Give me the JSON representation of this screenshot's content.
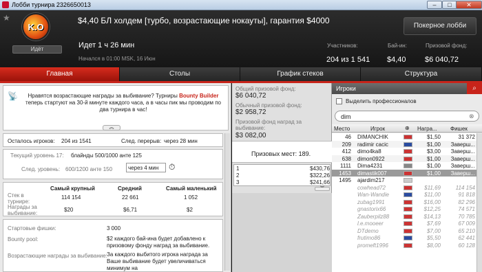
{
  "window": {
    "title": "Лобби турнира 2326650013",
    "min": "–",
    "max": "□",
    "close": "✕"
  },
  "header": {
    "logo_text": "K.O",
    "status": "Идёт",
    "title": "$4,40 БЛ холдем [турбо, возрастающие нокауты], гарантия $4000",
    "running": "Идет 1 ч 26 мин",
    "started": "Начался в 01:00 MSK, 16 Июн",
    "lobby_button": "Покерное лобби",
    "participants_label": "Участников:",
    "participants_value": "204 из 1 541",
    "buyin_label": "Бай-ин:",
    "buyin_value": "$4,40",
    "prize_label": "Призовой фонд:",
    "prize_value": "$6 040,72"
  },
  "tabs": [
    "Главная",
    "Столы",
    "График стеков",
    "Структура"
  ],
  "notice": "Нравятся возрастающие награды за выбивание? Турниры Bounty Builder теперь стартуют на 30-й минуте каждого часа, а в часы пик мы проводим по два турнира в час!",
  "info": {
    "remaining_label": "Осталось игроков:",
    "remaining_value": "204 из 1541",
    "break_label": "След. перерыв:",
    "break_value": "через 28 мин",
    "level_label": "Текущий уровень 17:",
    "level_value": "блайнды 500/1000 анте 125",
    "next_label": "След. уровень:",
    "next_value": "600/1200 анте 150",
    "next_time": "через 4 мин"
  },
  "stacks": {
    "headers": [
      "Самый крупный",
      "Средний",
      "Самый маленький"
    ],
    "row1_label": "Стек в турнире:",
    "row1": [
      "114 154",
      "22 661",
      "1 052"
    ],
    "row2_label": "Награды за выбивание:",
    "row2": [
      "$20",
      "$6,71",
      "$2"
    ]
  },
  "details": {
    "start_label": "Стартовые фишки:",
    "start_value": "3 000",
    "pool_label": "Bounty pool:",
    "pool_value": "$2 каждого бай-ина будет добавлено к призовому фонду наград за выбивание.",
    "inc_label": "Возрастающие награды за выбивание:",
    "inc_value": "За каждого выбитого игрока награда за Ваше выбивание будет увеличиваться минимум на"
  },
  "prizes": {
    "total_label": "Общий призовой фонд:",
    "total_value": "$6 040,72",
    "normal_label": "Обычный призовой фонд:",
    "normal_value": "$2 958,72",
    "bounty_label": "Призовой фонд наград за выбивание:",
    "bounty_value": "$3 082,00",
    "places": "Призовых мест: 189.",
    "rows": [
      {
        "place": "1",
        "amount": "$430,76"
      },
      {
        "place": "2",
        "amount": "$322,26"
      },
      {
        "place": "3",
        "amount": "$241,66"
      }
    ]
  },
  "players": {
    "title": "Игроки",
    "highlight_label": "Выделить профессионалов",
    "search_value": "dim",
    "columns": [
      "Место",
      "Игрок",
      "",
      "Награ...",
      "Фишек"
    ],
    "rows": [
      {
        "place": "46",
        "name": "DIMANCHIK",
        "bounty": "$1,50",
        "chips": "31 372",
        "flag": "#c33"
      },
      {
        "place": "209",
        "name": "radimir cacic",
        "bounty": "$1,00",
        "chips": "Заверш...",
        "flag": "#2a4ca0"
      },
      {
        "place": "412",
        "name": "dimo4ka8",
        "bounty": "$3,00",
        "chips": "Заверш...",
        "flag": "#c33"
      },
      {
        "place": "638",
        "name": "dimon0922",
        "bounty": "$1,00",
        "chips": "Заверш...",
        "flag": "#c33"
      },
      {
        "place": "1111",
        "name": "Dima4231",
        "bounty": "$1,00",
        "chips": "Заверш...",
        "flag": "#888"
      },
      {
        "place": "1453",
        "name": "dimastik007",
        "bounty": "$1,00",
        "chips": "Заверш...",
        "flag": "#c33"
      },
      {
        "place": "1495",
        "name": "ajardim217",
        "bounty": "",
        "chips": "",
        "flag": "#ccc"
      },
      {
        "place": "",
        "name": "cowhead72",
        "bounty": "$11,69",
        "chips": "114 154",
        "flag": "#c33"
      },
      {
        "place": "",
        "name": "Wan-Wandie",
        "bounty": "$11,00",
        "chips": "91 818",
        "flag": "#2a4ca0"
      },
      {
        "place": "",
        "name": "zubag1991",
        "bounty": "$16,00",
        "chips": "82 296",
        "flag": "#c33"
      },
      {
        "place": "",
        "name": "gnastorix66",
        "bounty": "$12,25",
        "chips": "74 571",
        "flag": "#c33"
      },
      {
        "place": "",
        "name": "Zauberpilz88",
        "bounty": "$14,13",
        "chips": "70 785",
        "flag": "#c33"
      },
      {
        "place": "",
        "name": "l.e.mooeer",
        "bounty": "$7,69",
        "chips": "67 009",
        "flag": "#c33"
      },
      {
        "place": "",
        "name": "DTdemo",
        "bounty": "$7,00",
        "chips": "65 210",
        "flag": "#c33"
      },
      {
        "place": "",
        "name": "frutimo86",
        "bounty": "$5,50",
        "chips": "62 441",
        "flag": "#2a4ca0"
      },
      {
        "place": "",
        "name": "promeft1996",
        "bounty": "$8,00",
        "chips": "60 128",
        "flag": "#c33"
      }
    ]
  },
  "colors": {
    "accent": "#c8241a",
    "header_bg": "#1f1f1f"
  }
}
